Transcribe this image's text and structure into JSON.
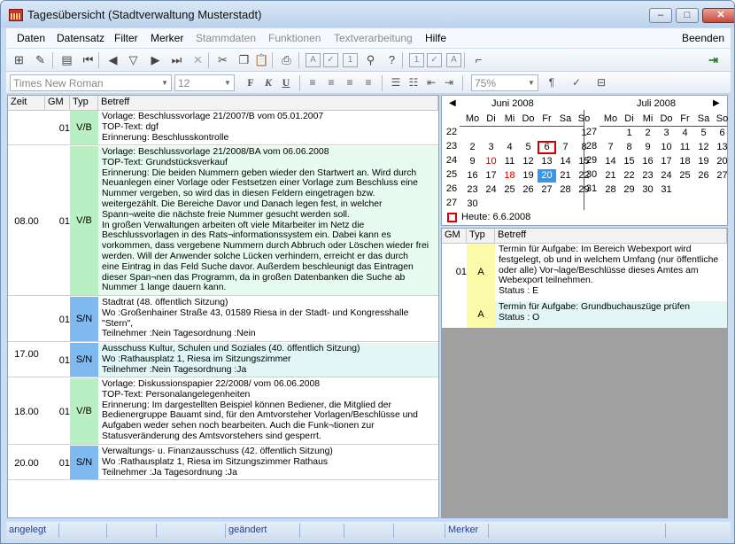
{
  "window": {
    "title": "Tagesübersicht (Stadtverwaltung Musterstadt)",
    "min": "–",
    "max": "□",
    "close": "✕"
  },
  "menu": [
    {
      "label": "Daten",
      "enabled": true
    },
    {
      "label": "Datensatz",
      "enabled": true
    },
    {
      "label": "Filter",
      "enabled": true
    },
    {
      "label": "Merker",
      "enabled": true
    },
    {
      "label": "Stammdaten",
      "enabled": false
    },
    {
      "label": "Funktionen",
      "enabled": false
    },
    {
      "label": "Textverarbeitung",
      "enabled": false
    },
    {
      "label": "Hilfe",
      "enabled": true
    }
  ],
  "menu_right": "Beenden",
  "toolbar": {
    "font": "Times New Roman",
    "size": "12",
    "zoom": "75%",
    "bold": "F",
    "italic": "K",
    "underline": "U",
    "icons": [
      "new-record-icon",
      "edit-icon",
      "save-icon",
      "first-record-icon",
      "prev-record-icon",
      "filter-record-icon",
      "next-record-icon",
      "last-record-icon",
      "delete-icon",
      "cut-icon",
      "copy-icon",
      "paste-icon",
      "print-icon",
      "field-a-icon",
      "field-check-icon",
      "field-1-icon",
      "search-binoculars-icon",
      "help-icon",
      "text-1-icon",
      "text-check-icon",
      "text-a-icon",
      "stamp-icon",
      "exit-door-icon"
    ],
    "icon_glyphs": [
      "⊞",
      "✎",
      "▤",
      "⏮",
      "◀",
      "▽",
      "▶",
      "⏭",
      "✕",
      "✂",
      "❐",
      "📋",
      "⎙",
      "A",
      "✓",
      "1",
      "⚲",
      "?",
      "1",
      "✓",
      "A",
      "⌐",
      "⇥"
    ]
  },
  "left_table": {
    "headers": [
      "Zeit",
      "GM",
      "Typ",
      "Betreff"
    ],
    "rows": [
      {
        "zeit": "",
        "gm": "01",
        "typ": "V/B",
        "lines": [
          "Vorlage: Beschlussvorlage 21/2007/B vom 05.01.2007",
          "TOP-Text: dgf",
          "Erinnerung: Beschlusskontrolle"
        ]
      },
      {
        "zeit": "08.00",
        "gm": "01",
        "typ": "V/B",
        "lines": [
          "Vorlage: Beschlussvorlage 21/2008/BA vom 06.06.2008",
          "TOP-Text: Grundstücksverkauf",
          "Erinnerung: Die beiden Nummern geben wieder den Startwert an. Wird durch",
          "Neuanlegen einer Vorlage oder Festsetzen einer Vorlage zum Beschluss eine",
          "Nummer vergeben, so wird das in diesen Feldern eingetragen bzw.",
          "weitergezählt. Die Bereiche Davor und Danach legen fest, in welcher",
          "Spann¬weite  die nächste freie Nummer gesucht werden soll.",
          "In großen Verwaltungen arbeiten oft viele Mitarbeiter im Netz die",
          "Beschlussvorlagen in des Rats¬informationssystem ein. Dabei kann es",
          "vorkommen, dass vergebene Nummern durch Abbruch oder Löschen wieder frei",
          "werden. Will der Anwender solche Lücken verhindern, erreicht er das durch",
          "eine Eintrag in das Feld Suche davor. Außerdem beschleunigt das Eintragen",
          "dieser Span¬nen das Programm, da in großen Datenbanken die Suche ab",
          "Nummer 1 lange dauern kann."
        ]
      },
      {
        "zeit": "17.00",
        "gm": "01",
        "typ": "S/N",
        "lines": [
          "Stadtrat (48. öffentlich Sitzung)",
          "Wo :Großenhainer Straße 43, 01589 Riesa in der Stadt- und Kongresshalle",
          "\"Stern\",",
          "Teilnehmer :Nein Tagesordnung :Nein"
        ]
      },
      {
        "zeit": "",
        "gm": "01",
        "typ": "S/N",
        "lines": [
          "Ausschuss Kultur, Schulen und Soziales (40. öffentlich Sitzung)",
          "Wo :Rathausplatz 1, Riesa im Sitzungszimmer",
          "Teilnehmer :Nein Tagesordnung :Ja"
        ]
      },
      {
        "zeit": "18.00",
        "gm": "01",
        "typ": "V/B",
        "lines": [
          "Vorlage: Diskussionspapier 22/2008/ vom 06.06.2008",
          "TOP-Text: Personalangelegenheiten",
          "Erinnerung: Im dargestellten Beispiel können Bediener, die Mitglied der",
          "Bedienergruppe Bauamt sind, für den Amtvorsteher Vorlagen/Beschlüsse und",
          "Aufgaben weder sehen noch bearbeiten. Auch die Funk¬tionen zur",
          "Statusveränderung des Amtsvorstehers sind gesperrt."
        ]
      },
      {
        "zeit": "20.00",
        "gm": "01",
        "typ": "S/N",
        "lines": [
          "Verwaltungs- u. Finanzausschuss (42. öffentlich Sitzung)",
          "Wo :Rathausplatz 1, Riesa im Sitzungszimmer Rathaus",
          "Teilnehmer :Ja    Tagesordnung :Ja"
        ]
      }
    ]
  },
  "calendar": {
    "prev": "◀",
    "next": "▶",
    "months": [
      {
        "title": "Juni 2008",
        "weekdays": [
          "Mo",
          "Di",
          "Mi",
          "Do",
          "Fr",
          "Sa",
          "So"
        ],
        "weeks": [
          {
            "wk": "22",
            "days": [
              "",
              "",
              "",
              "",
              "",
              "",
              "1"
            ]
          },
          {
            "wk": "23",
            "days": [
              "2",
              "3",
              "4",
              "5",
              "6",
              "7",
              "8"
            ]
          },
          {
            "wk": "24",
            "days": [
              "9",
              "10",
              "11",
              "12",
              "13",
              "14",
              "15"
            ]
          },
          {
            "wk": "25",
            "days": [
              "16",
              "17",
              "18",
              "19",
              "20",
              "21",
              "22"
            ]
          },
          {
            "wk": "26",
            "days": [
              "23",
              "24",
              "25",
              "26",
              "27",
              "28",
              "29"
            ]
          },
          {
            "wk": "27",
            "days": [
              "30",
              "",
              "",
              "",
              "",
              "",
              ""
            ]
          }
        ]
      },
      {
        "title": "Juli 2008",
        "weekdays": [
          "Mo",
          "Di",
          "Mi",
          "Do",
          "Fr",
          "Sa",
          "So"
        ],
        "weeks": [
          {
            "wk": "27",
            "days": [
              "",
              "1",
              "2",
              "3",
              "4",
              "5",
              "6"
            ]
          },
          {
            "wk": "28",
            "days": [
              "7",
              "8",
              "9",
              "10",
              "11",
              "12",
              "13"
            ]
          },
          {
            "wk": "29",
            "days": [
              "14",
              "15",
              "16",
              "17",
              "18",
              "19",
              "20"
            ]
          },
          {
            "wk": "30",
            "days": [
              "21",
              "22",
              "23",
              "24",
              "25",
              "26",
              "27"
            ]
          },
          {
            "wk": "31",
            "days": [
              "28",
              "29",
              "30",
              "31",
              "",
              "",
              ""
            ]
          }
        ]
      }
    ],
    "today_label": "Heute: 6.6.2008",
    "red_days": [
      "10",
      "18"
    ],
    "selected_day": "20",
    "today_day": "6",
    "colors": {
      "red": "#d00000",
      "selected": "#3399ee"
    }
  },
  "right_table": {
    "headers": [
      "GM",
      "Typ",
      "Betreff"
    ],
    "rows": [
      {
        "gm": "01",
        "typ": "A",
        "lines": [
          "Termin für Aufgabe: Im Bereich Webexport wird",
          "festgelegt, ob und in welchem Umfang (nur öffentliche",
          "oder alle) Vor¬lage/Beschlüsse dieses Amtes am",
          "Webexport teilnehmen.",
          "Status : E"
        ]
      },
      {
        "gm": "",
        "typ": "A",
        "lines": [
          "Termin für Aufgabe: Grundbuchauszüge prüfen",
          "Status : O"
        ]
      }
    ]
  },
  "statusbar": [
    "angelegt",
    "",
    "",
    "",
    "geändert",
    "",
    "",
    "",
    "Merker",
    ""
  ]
}
